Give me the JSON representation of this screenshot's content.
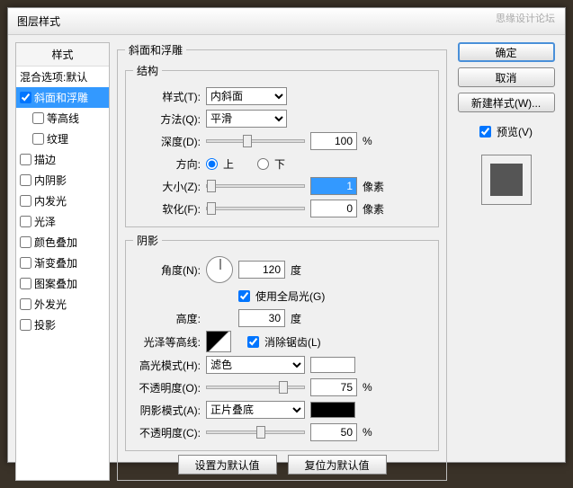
{
  "window": {
    "title": "图层样式"
  },
  "sidebar": {
    "header": "样式",
    "blending": "混合选项:默认",
    "items": [
      {
        "label": "斜面和浮雕",
        "checked": true,
        "selected": true
      },
      {
        "label": "等高线",
        "checked": false,
        "sub": true
      },
      {
        "label": "纹理",
        "checked": false,
        "sub": true
      },
      {
        "label": "描边",
        "checked": false
      },
      {
        "label": "内阴影",
        "checked": false
      },
      {
        "label": "内发光",
        "checked": false
      },
      {
        "label": "光泽",
        "checked": false
      },
      {
        "label": "颜色叠加",
        "checked": false
      },
      {
        "label": "渐变叠加",
        "checked": false
      },
      {
        "label": "图案叠加",
        "checked": false
      },
      {
        "label": "外发光",
        "checked": false
      },
      {
        "label": "投影",
        "checked": false
      }
    ]
  },
  "bevel": {
    "title": "斜面和浮雕",
    "structure": {
      "legend": "结构",
      "style_label": "样式(T):",
      "style_value": "内斜面",
      "technique_label": "方法(Q):",
      "technique_value": "平滑",
      "depth_label": "深度(D):",
      "depth_value": "100",
      "depth_unit": "%",
      "direction_label": "方向:",
      "up": "上",
      "down": "下",
      "size_label": "大小(Z):",
      "size_value": "1",
      "size_unit": "像素",
      "soften_label": "软化(F):",
      "soften_value": "0",
      "soften_unit": "像素"
    },
    "shading": {
      "legend": "阴影",
      "angle_label": "角度(N):",
      "angle_value": "120",
      "angle_unit": "度",
      "global_light": "使用全局光(G)",
      "altitude_label": "高度:",
      "altitude_value": "30",
      "altitude_unit": "度",
      "gloss_label": "光泽等高线:",
      "antialias": "消除锯齿(L)",
      "highlight_mode_label": "高光模式(H):",
      "highlight_mode_value": "滤色",
      "highlight_opacity_label": "不透明度(O):",
      "highlight_opacity_value": "75",
      "highlight_opacity_unit": "%",
      "shadow_mode_label": "阴影模式(A):",
      "shadow_mode_value": "正片叠底",
      "shadow_opacity_label": "不透明度(C):",
      "shadow_opacity_value": "50",
      "shadow_opacity_unit": "%"
    },
    "buttons": {
      "default": "设置为默认值",
      "reset": "复位为默认值"
    }
  },
  "right": {
    "ok": "确定",
    "cancel": "取消",
    "new_style": "新建样式(W)...",
    "preview_label": "预览(V)"
  },
  "watermark": "思缘设计论坛"
}
